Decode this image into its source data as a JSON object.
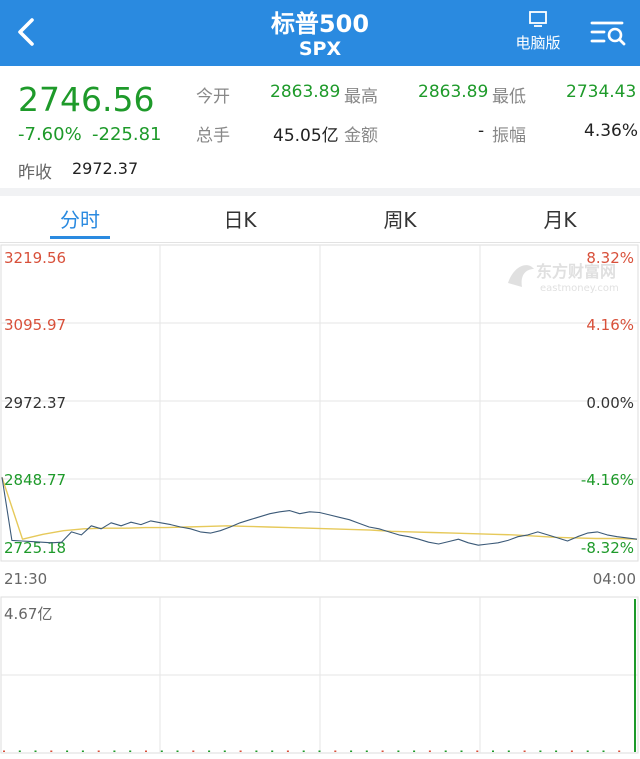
{
  "header": {
    "title": "标普500",
    "subtitle": "SPX",
    "pc_label": "电脑版",
    "colors": {
      "bar": "#2a8ae0"
    }
  },
  "quote": {
    "last": "2746.56",
    "change_pct": "-7.60%",
    "change": "-225.81",
    "prev_close_label": "昨收",
    "prev_close": "2972.37",
    "open_label": "今开",
    "open": "2863.89",
    "high_label": "最高",
    "high": "2863.89",
    "low_label": "最低",
    "low": "2734.43",
    "volume_label": "总手",
    "volume": "45.05亿",
    "amount_label": "金额",
    "amount": "-",
    "amplitude_label": "振幅",
    "amplitude": "4.36%"
  },
  "tabs": [
    {
      "label": "分时",
      "active": true
    },
    {
      "label": "日K",
      "active": false
    },
    {
      "label": "周K",
      "active": false
    },
    {
      "label": "月K",
      "active": false
    }
  ],
  "chart": {
    "watermark_cn": "东方财富网",
    "watermark_en": "eastmoney.com",
    "y_left": [
      "3219.56",
      "3095.97",
      "2972.37",
      "2848.77",
      "2725.18"
    ],
    "y_right": [
      "8.32%",
      "4.16%",
      "0.00%",
      "-4.16%",
      "-8.32%"
    ],
    "x_start": "21:30",
    "x_end": "04:00",
    "vol_max_label": "4.67亿",
    "colors": {
      "up": "#d8503a",
      "down": "#1e9a2a",
      "flat": "#333333",
      "price_line": "#3c5a78",
      "avg_line": "#e6c95a"
    }
  },
  "chart_data": {
    "type": "line",
    "ylim": [
      2725.18,
      3219.56
    ],
    "series": [
      {
        "values": [
          2850,
          2746,
          2745,
          2744,
          2743,
          2742,
          2743,
          2760,
          2755,
          2770,
          2765,
          2775,
          2770,
          2776,
          2772,
          2778,
          2775,
          2772,
          2768,
          2765,
          2760,
          2758,
          2762,
          2768,
          2775,
          2780,
          2785,
          2790,
          2793,
          2795,
          2790,
          2793,
          2792,
          2788,
          2784,
          2780,
          2774,
          2768,
          2765,
          2760,
          2755,
          2752,
          2748,
          2743,
          2740,
          2744,
          2748,
          2742,
          2738,
          2740,
          2742,
          2746,
          2752,
          2755,
          2760,
          2755,
          2750,
          2745,
          2752,
          2758,
          2760,
          2755,
          2752,
          2750,
          2748
        ]
      },
      {
        "values": [
          2850,
          2748,
          2756,
          2762,
          2765,
          2766,
          2766,
          2767,
          2767,
          2768,
          2769,
          2770,
          2769,
          2768,
          2767,
          2766,
          2765,
          2764,
          2763,
          2761,
          2760,
          2759,
          2758,
          2757,
          2756,
          2755,
          2753,
          2751,
          2750,
          2749,
          2749,
          2748
        ]
      }
    ],
    "volume": [
      0.02,
      0.01,
      0.02,
      0.01,
      0.01,
      0.02,
      0.01,
      0.02,
      0.01,
      0.02,
      0.03,
      0.01,
      0.02,
      0.01,
      0.02,
      0.01,
      0.02,
      0.01,
      0.02,
      0.01,
      0.02,
      0.01,
      0.02,
      0.01,
      0.02,
      0.01,
      0.02,
      0.01,
      0.02,
      0.01,
      0.02,
      0.01,
      0.02,
      0.01,
      0.02,
      0.01,
      0.02,
      0.01,
      0.02,
      0.03,
      4.67
    ]
  }
}
